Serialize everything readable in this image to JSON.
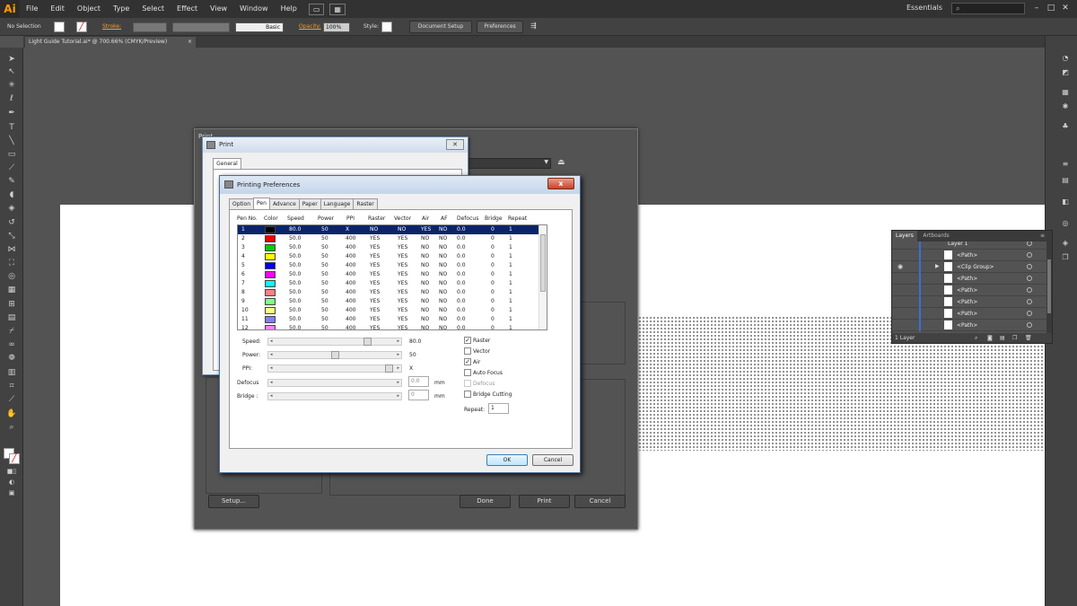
{
  "menubar": {
    "logo": "Ai",
    "items": [
      "File",
      "Edit",
      "Object",
      "Type",
      "Select",
      "Effect",
      "View",
      "Window",
      "Help"
    ],
    "workspace": "Essentials",
    "search_placeholder": ""
  },
  "controlbar": {
    "selection": "No Selection",
    "stroke_label": "Stroke:",
    "brush": "Basic",
    "opacity_label": "Opacity:",
    "opacity_value": "100%",
    "style_label": "Style:",
    "document_setup": "Document Setup",
    "preferences": "Preferences"
  },
  "document": {
    "tab_title": "Light Guide Tutorial.ai* @ 700.66% (CMYK/Preview)",
    "close": "×"
  },
  "layers_panel": {
    "tabs": [
      "Layers",
      "Artboards"
    ],
    "rows": [
      "Layer 1",
      "<Path>",
      "<Clip Group>",
      "<Path>",
      "<Path>",
      "<Path>",
      "<Path>",
      "<Path>"
    ],
    "footer": "1 Layer"
  },
  "ai_print": {
    "title": "Print",
    "setup": "Setup...",
    "done": "Done",
    "print": "Print",
    "cancel": "Cancel"
  },
  "win_print": {
    "title": "Print",
    "tab": "General"
  },
  "prefs": {
    "title": "Printing Preferences",
    "tabs": [
      "Option",
      "Pen",
      "Advance",
      "Paper",
      "Language",
      "Raster"
    ],
    "active_tab": "Pen",
    "headers": [
      "Pen No.",
      "Color",
      "Speed",
      "Power",
      "PPI",
      "Raster",
      "Vector",
      "Air",
      "AF",
      "Defocus",
      "Bridge",
      "Repeat"
    ],
    "rows": [
      {
        "no": "1",
        "color": "#000000",
        "speed": "80.0",
        "power": "50",
        "ppi": "X",
        "raster": "NO",
        "vector": "NO",
        "air": "YES",
        "af": "NO",
        "defocus": "0.0",
        "bridge": "0",
        "repeat": "1"
      },
      {
        "no": "2",
        "color": "#ff0000",
        "speed": "50.0",
        "power": "50",
        "ppi": "400",
        "raster": "YES",
        "vector": "YES",
        "air": "NO",
        "af": "NO",
        "defocus": "0.0",
        "bridge": "0",
        "repeat": "1"
      },
      {
        "no": "3",
        "color": "#00cc00",
        "speed": "50.0",
        "power": "50",
        "ppi": "400",
        "raster": "YES",
        "vector": "YES",
        "air": "NO",
        "af": "NO",
        "defocus": "0.0",
        "bridge": "0",
        "repeat": "1"
      },
      {
        "no": "4",
        "color": "#ffff00",
        "speed": "50.0",
        "power": "50",
        "ppi": "400",
        "raster": "YES",
        "vector": "YES",
        "air": "NO",
        "af": "NO",
        "defocus": "0.0",
        "bridge": "0",
        "repeat": "1"
      },
      {
        "no": "5",
        "color": "#0000ff",
        "speed": "50.0",
        "power": "50",
        "ppi": "400",
        "raster": "YES",
        "vector": "YES",
        "air": "NO",
        "af": "NO",
        "defocus": "0.0",
        "bridge": "0",
        "repeat": "1"
      },
      {
        "no": "6",
        "color": "#ff00ff",
        "speed": "50.0",
        "power": "50",
        "ppi": "400",
        "raster": "YES",
        "vector": "YES",
        "air": "NO",
        "af": "NO",
        "defocus": "0.0",
        "bridge": "0",
        "repeat": "1"
      },
      {
        "no": "7",
        "color": "#00ffff",
        "speed": "50.0",
        "power": "50",
        "ppi": "400",
        "raster": "YES",
        "vector": "YES",
        "air": "NO",
        "af": "NO",
        "defocus": "0.0",
        "bridge": "0",
        "repeat": "1"
      },
      {
        "no": "8",
        "color": "#ff8080",
        "speed": "50.0",
        "power": "50",
        "ppi": "400",
        "raster": "YES",
        "vector": "YES",
        "air": "NO",
        "af": "NO",
        "defocus": "0.0",
        "bridge": "0",
        "repeat": "1"
      },
      {
        "no": "9",
        "color": "#80ff80",
        "speed": "50.0",
        "power": "50",
        "ppi": "400",
        "raster": "YES",
        "vector": "YES",
        "air": "NO",
        "af": "NO",
        "defocus": "0.0",
        "bridge": "0",
        "repeat": "1"
      },
      {
        "no": "10",
        "color": "#ffff80",
        "speed": "50.0",
        "power": "50",
        "ppi": "400",
        "raster": "YES",
        "vector": "YES",
        "air": "NO",
        "af": "NO",
        "defocus": "0.0",
        "bridge": "0",
        "repeat": "1"
      },
      {
        "no": "11",
        "color": "#8080ff",
        "speed": "50.0",
        "power": "50",
        "ppi": "400",
        "raster": "YES",
        "vector": "YES",
        "air": "NO",
        "af": "NO",
        "defocus": "0.0",
        "bridge": "0",
        "repeat": "1"
      },
      {
        "no": "12",
        "color": "#ff80ff",
        "speed": "50.0",
        "power": "50",
        "ppi": "400",
        "raster": "YES",
        "vector": "YES",
        "air": "NO",
        "af": "NO",
        "defocus": "0.0",
        "bridge": "0",
        "repeat": "1"
      }
    ],
    "speed_label": "Speed:",
    "speed_value": "80.0",
    "power_label": "Power:",
    "power_value": "50",
    "ppi_label": "PPI:",
    "ppi_value": "X",
    "defocus_label": "Defocus",
    "defocus_value": "0.0",
    "bridge_label": "Bridge :",
    "bridge_value": "0",
    "unit_mm": "mm",
    "checkboxes": [
      {
        "label": "Raster",
        "checked": "✓"
      },
      {
        "label": "Vector",
        "checked": ""
      },
      {
        "label": "Air",
        "checked": "✓"
      },
      {
        "label": "Auto Focus",
        "checked": ""
      },
      {
        "label": "Defocus",
        "checked": ""
      },
      {
        "label": "Bridge Cutting",
        "checked": ""
      }
    ],
    "repeat_label": "Repeat:",
    "repeat_value": "1",
    "ok": "OK",
    "cancel": "Cancel",
    "close": "x"
  }
}
